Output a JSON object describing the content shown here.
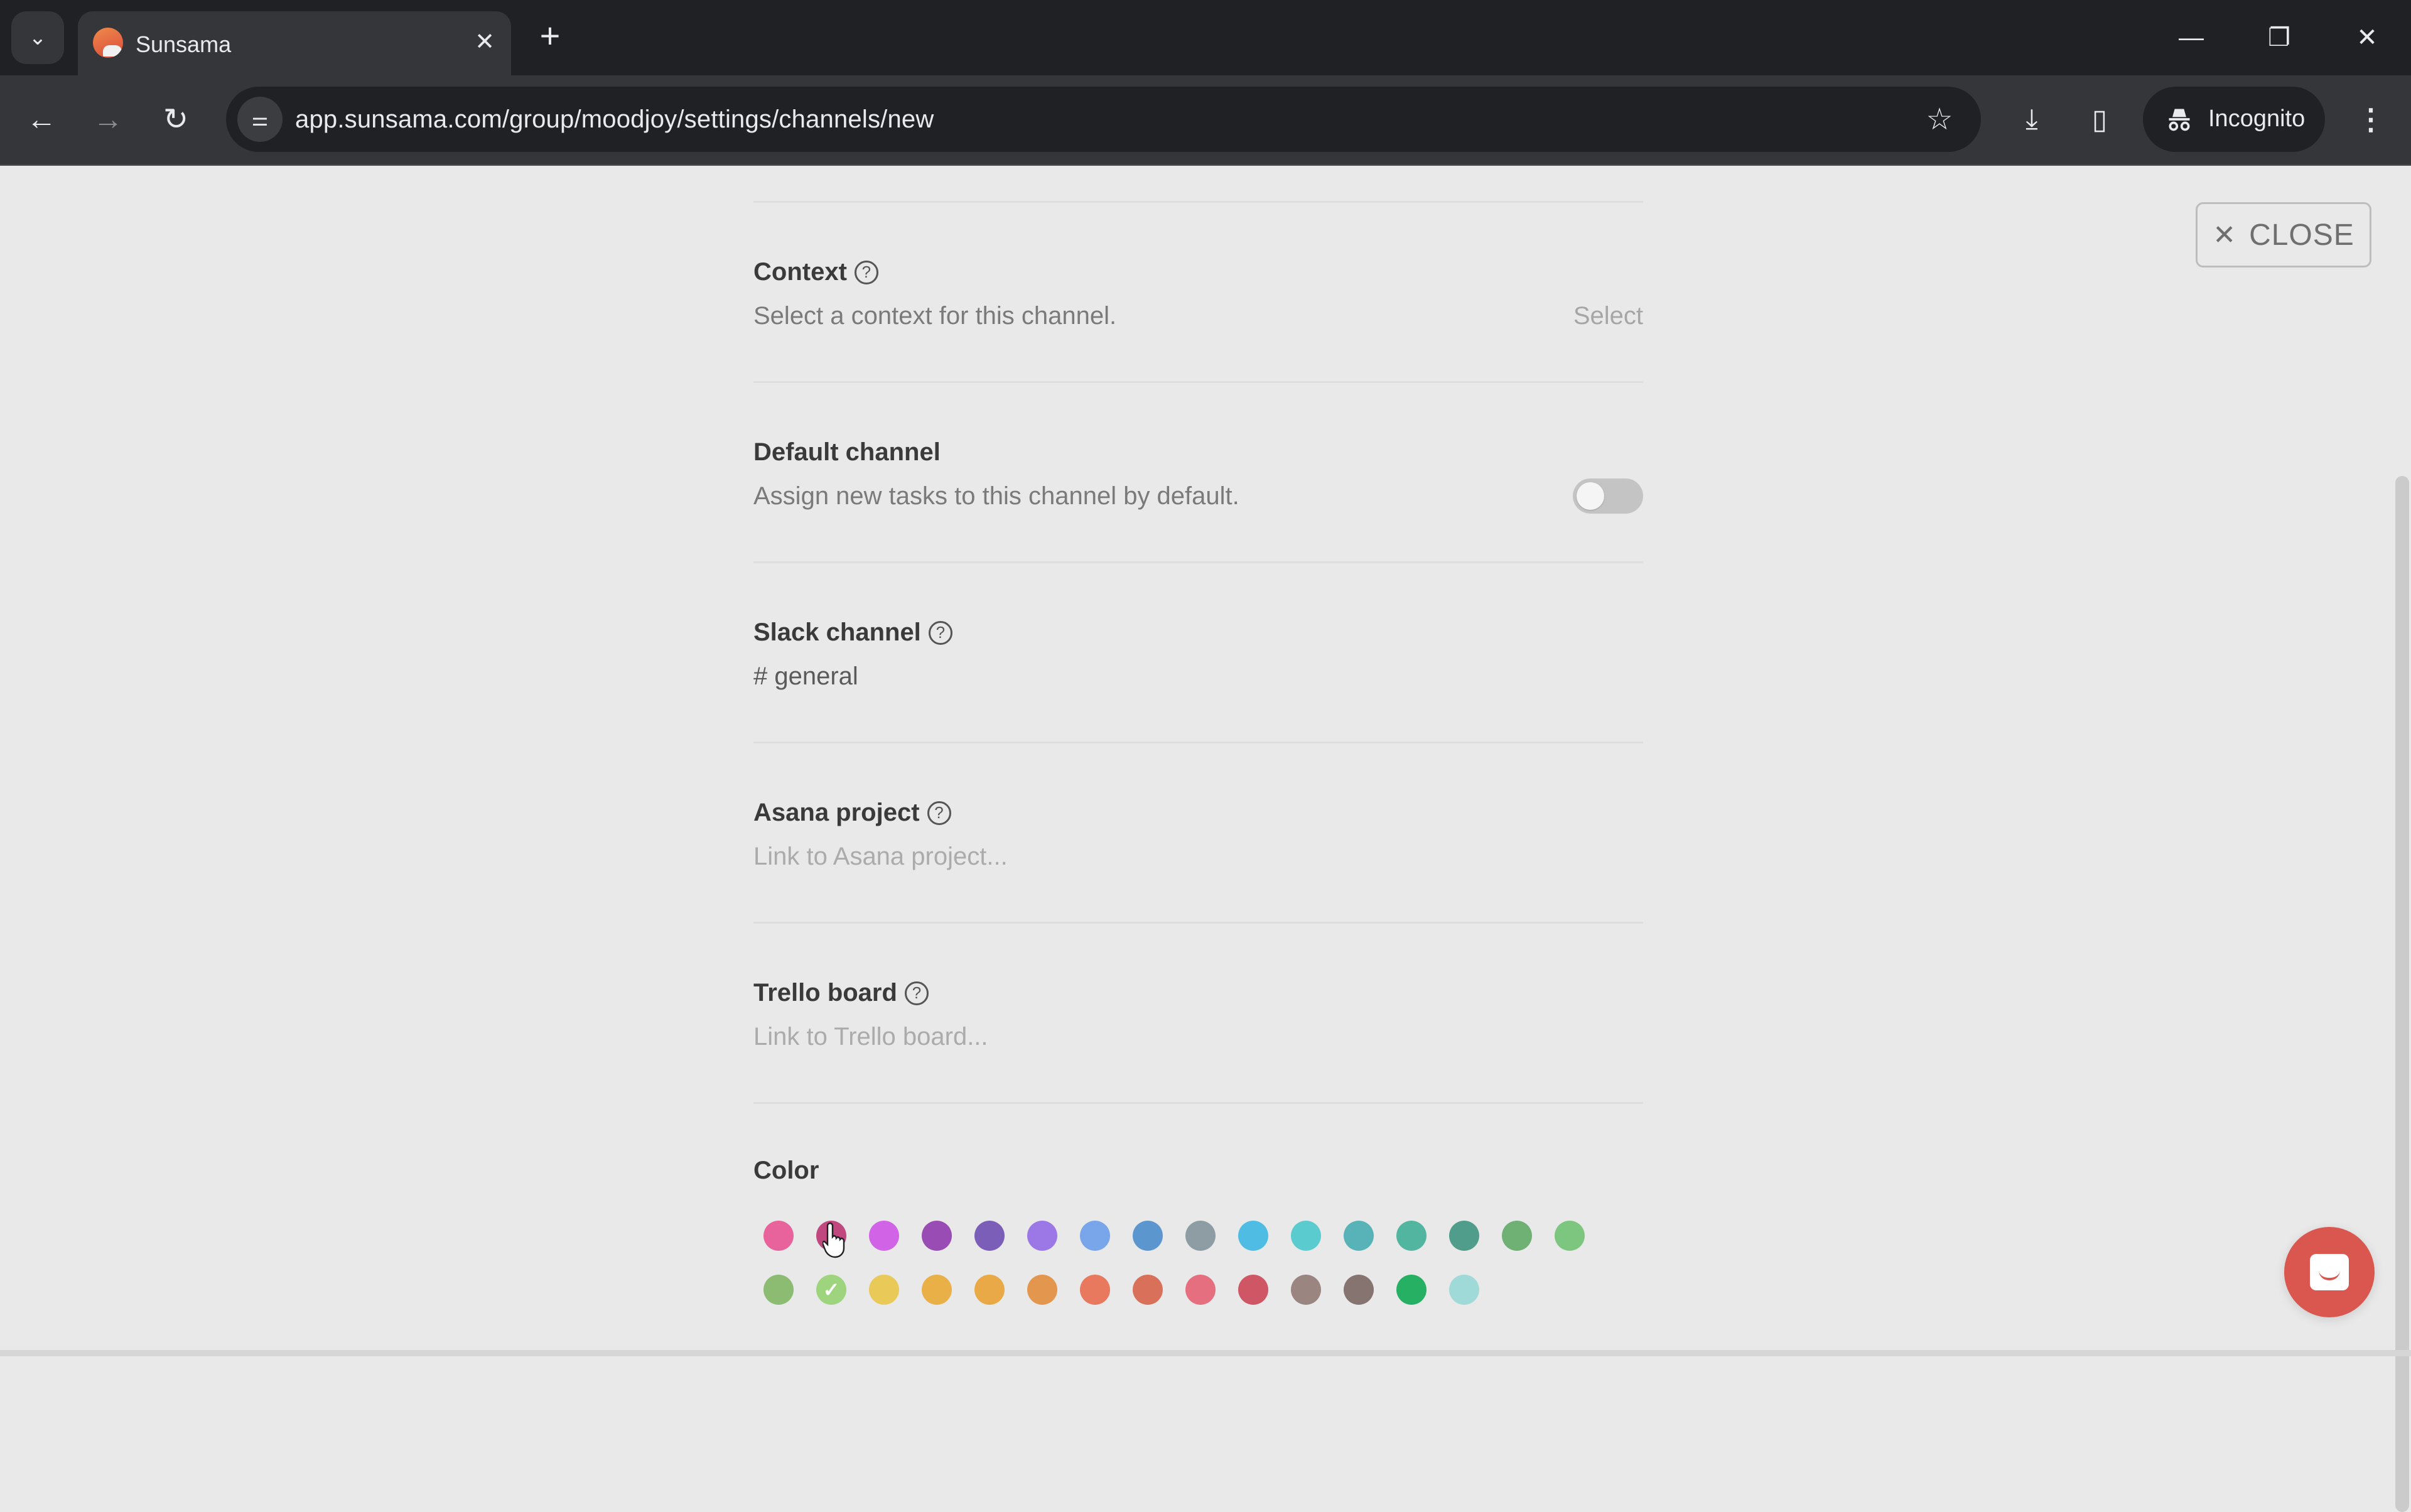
{
  "browser": {
    "tab_title": "Sunsama",
    "url": "app.sunsama.com/group/moodjoy/settings/channels/new",
    "incognito_label": "Incognito",
    "icons": {
      "tab_list": "chevron-down-icon",
      "tab_close": "close-icon",
      "new_tab": "plus-icon",
      "back": "arrow-left-icon",
      "forward": "arrow-right-icon",
      "reload": "reload-icon",
      "site_info": "tune-icon",
      "bookmark": "star-icon",
      "download": "download-icon",
      "side_panel": "side-panel-icon",
      "incognito": "incognito-icon",
      "menu": "more-vert-icon",
      "minimize": "minimize-icon",
      "restore": "restore-icon",
      "close_window": "close-icon"
    },
    "glyphs": {
      "tab_list": "⌄",
      "tab_close": "✕",
      "new_tab": "+",
      "back": "←",
      "forward": "→",
      "reload": "↻",
      "site_info": "⚌",
      "bookmark": "☆",
      "download": "⤓",
      "side_panel": "▯",
      "menu": "⋮",
      "minimize": "—",
      "restore": "❐",
      "close_window": "✕"
    }
  },
  "page": {
    "close_button": {
      "icon": "✕",
      "label": "CLOSE"
    },
    "sections": {
      "context": {
        "label": "Context",
        "help": "?",
        "description": "Select a context for this channel.",
        "action": "Select"
      },
      "default_channel": {
        "label": "Default channel",
        "description": "Assign new tasks to this channel by default.",
        "toggle_on": false
      },
      "slack_channel": {
        "label": "Slack channel",
        "help": "?",
        "value": "# general"
      },
      "asana_project": {
        "label": "Asana project",
        "help": "?",
        "placeholder": "Link to Asana project..."
      },
      "trello_board": {
        "label": "Trello board",
        "help": "?",
        "placeholder": "Link to Trello board..."
      }
    },
    "color": {
      "label": "Color",
      "selected_index": 17,
      "check_glyph": "✓",
      "swatches": [
        "#e8629c",
        "#c1477f",
        "#d063e6",
        "#9a4cb5",
        "#7b5eb8",
        "#9b78e6",
        "#79a5ea",
        "#5b96cf",
        "#8d9da3",
        "#4fbde3",
        "#5acbcf",
        "#57b3b7",
        "#52b5a0",
        "#4f9d8a",
        "#6fb075",
        "#7dc67f",
        "#8cbb72",
        "#9ed47e",
        "#e9c957",
        "#e9b048",
        "#e9a947",
        "#e3974e",
        "#e8795f",
        "#d9715a",
        "#e56f7f",
        "#cf5765",
        "#9a8580",
        "#85746f",
        "#26b063",
        "#9fd9d8"
      ],
      "row_size": 16
    },
    "chat_button_color": "#d9574f"
  }
}
